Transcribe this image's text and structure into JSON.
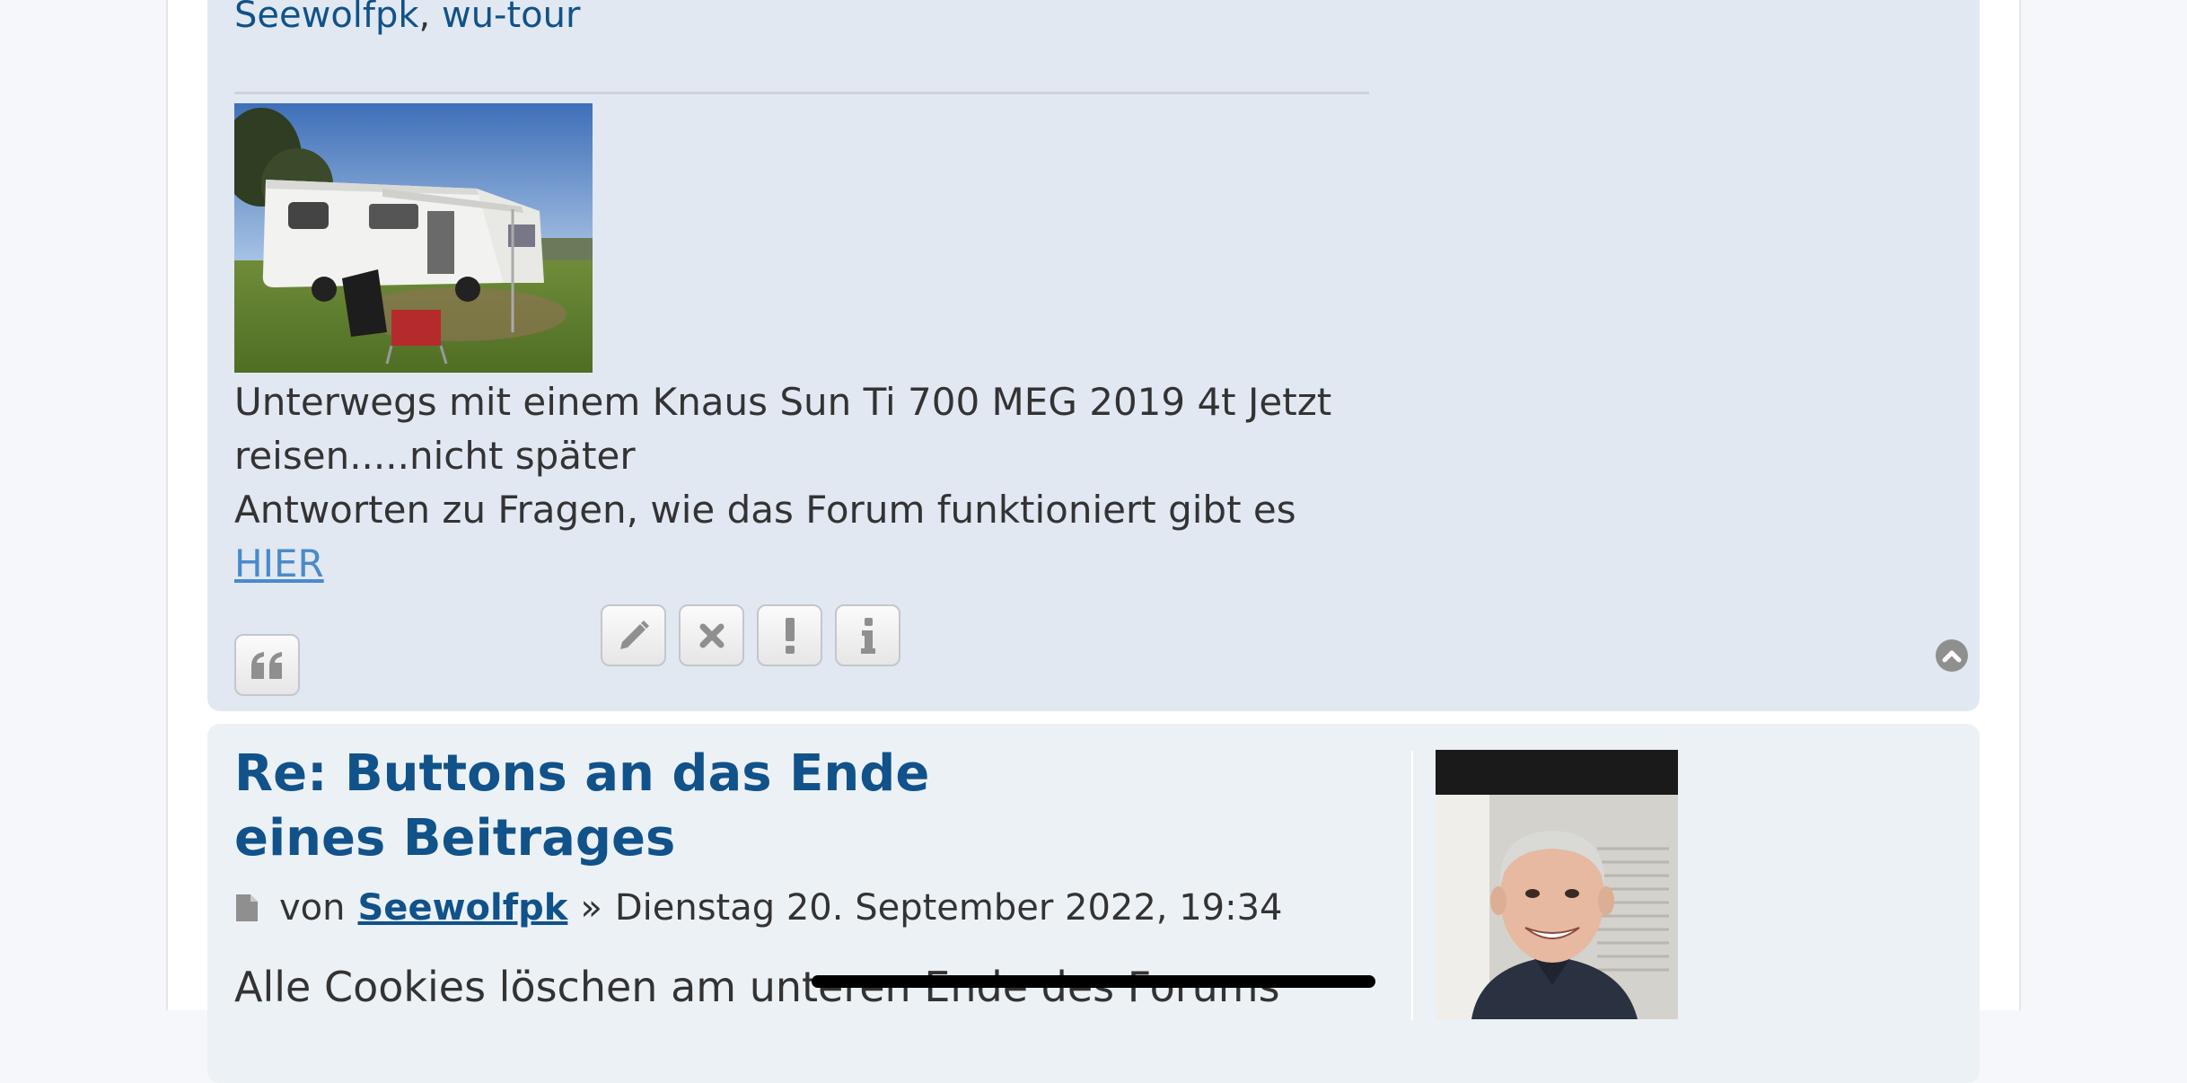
{
  "post1": {
    "thanked_users": [
      "Seewolfpk",
      "wu-tour"
    ],
    "thanks_separator": ", ",
    "signature": {
      "image_alt": "Wohnmobil auf Wiese",
      "line1": "Unterwegs mit einem Knaus Sun Ti 700 MEG 2019 4t Jetzt reisen.....nicht später",
      "line2": "Antworten zu Fragen, wie das Forum funktioniert gibt es",
      "link_text": "HIER"
    },
    "actions": {
      "quote": "quote-icon",
      "edit": "pencil-icon",
      "delete": "close-icon",
      "report": "exclamation-icon",
      "info": "info-icon",
      "top": "chevron-up-icon"
    }
  },
  "post2": {
    "title": "Re: Buttons an das Ende eines Beitrages",
    "meta": {
      "prefix": "von",
      "author": "Seewolfpk",
      "separator": "»",
      "date": "Dienstag 20. September 2022, 19:34"
    },
    "body": "Alle Cookies löschen am unteren Ende des Forums"
  },
  "colors": {
    "link": "#105289",
    "post_bg_alt": "#e1e8f1",
    "post_bg": "#ecf1f6",
    "signature_link": "#4a8acb"
  }
}
